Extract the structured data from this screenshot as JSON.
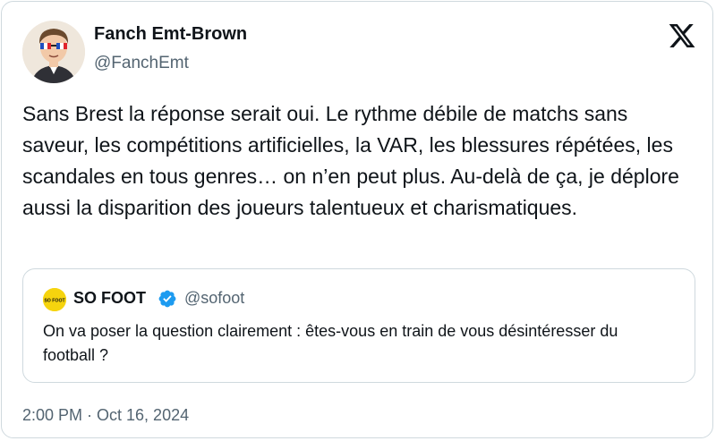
{
  "author": {
    "name": "Fanch Emt-Brown",
    "handle": "@FanchEmt"
  },
  "logo_icon": "x-logo-icon",
  "tweet": {
    "text": "Sans Brest la réponse serait oui. Le rythme débile de matchs sans saveur, les compétitions artificielles, la VAR, les blessures répétées, les scandales en tous genres… on n’en peut plus. Au-delà de ça, je déplore aussi la disparition des joueurs talentueux et charismatiques."
  },
  "quoted": {
    "avatar_text": "SO FOOT",
    "name": "SO FOOT",
    "verified": true,
    "handle": "@sofoot",
    "text": "On va poser la question clairement : êtes-vous en train de vous désintéresser du football ?"
  },
  "timestamp": "2:00 PM · Oct 16, 2024",
  "colors": {
    "text": "#0f1419",
    "secondary": "#536471",
    "border": "#cfd9de",
    "verified": "#1d9bf0",
    "sofoot_yellow": "#f6d40e"
  }
}
